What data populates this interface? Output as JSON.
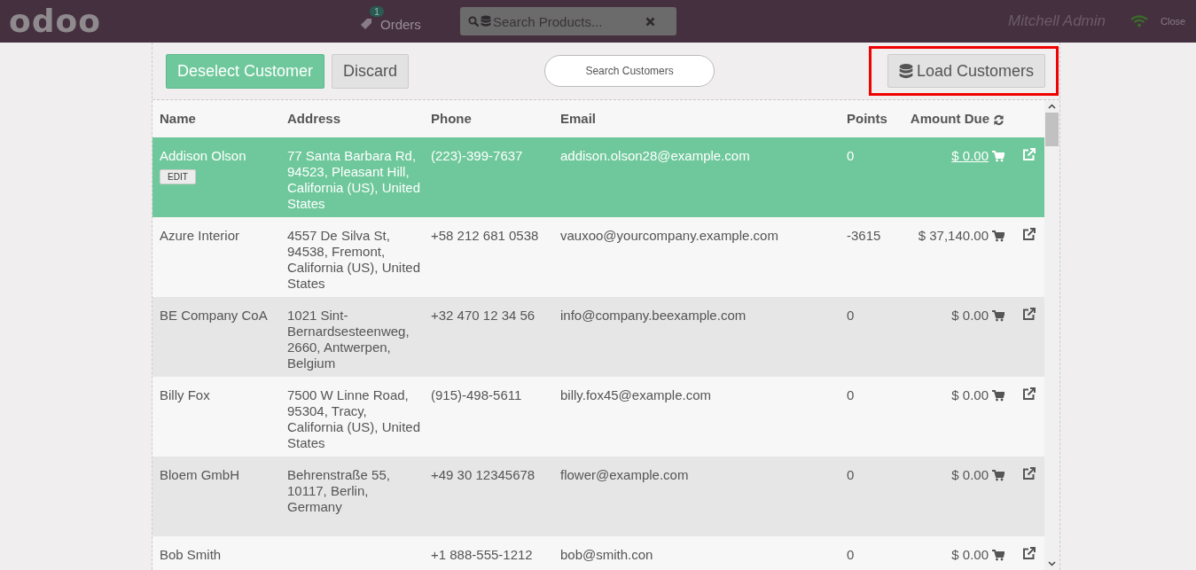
{
  "topbar": {
    "logo": "odoo",
    "orders": {
      "label": "Orders",
      "count": "1"
    },
    "product_search": {
      "placeholder": "Search Products..."
    },
    "user": "Mitchell Admin",
    "close": "Close"
  },
  "toolbar": {
    "deselect": "Deselect Customer",
    "discard": "Discard",
    "customer_search": {
      "placeholder": "Search Customers"
    },
    "load": {
      "label": "Load Customers",
      "highlighted": true
    }
  },
  "table": {
    "columns": [
      "Name",
      "Address",
      "Phone",
      "Email",
      "Points",
      "Amount Due"
    ],
    "rows": [
      {
        "selected": true,
        "name": "Addison Olson",
        "edit": "EDIT",
        "address": "77 Santa Barbara Rd, 94523, Pleasant Hill, California (US), United States",
        "phone": "(223)-399-7637",
        "email": "addison.olson28@example.com",
        "points": "0",
        "amount_due": "$ 0.00"
      },
      {
        "selected": false,
        "name": "Azure Interior",
        "address": "4557 De Silva St, 94538, Fremont, California (US), United States",
        "phone": "+58 212 681 0538",
        "email": "vauxoo@yourcompany.example.com",
        "points": "-3615",
        "amount_due": "$ 37,140.00"
      },
      {
        "selected": false,
        "name": "BE Company CoA",
        "address": "1021 Sint-Bernardsesteenweg, 2660, Antwerpen, Belgium",
        "phone": "+32 470 12 34 56",
        "email": "info@company.beexample.com",
        "points": "0",
        "amount_due": "$ 0.00"
      },
      {
        "selected": false,
        "name": "Billy Fox",
        "address": "7500 W Linne Road, 95304, Tracy, California (US), United States",
        "phone": "(915)-498-5611",
        "email": "billy.fox45@example.com",
        "points": "0",
        "amount_due": "$ 0.00"
      },
      {
        "selected": false,
        "name": "Bloem GmbH",
        "address": "Behrenstraße 55, 10117, Berlin, Germany",
        "phone": "+49 30 12345678",
        "email": "flower@example.com",
        "points": "0",
        "amount_due": "$ 0.00"
      },
      {
        "selected": false,
        "name": "Bob Smith",
        "address": "",
        "phone": "+1 888-555-1212",
        "email": "bob@smith.con",
        "points": "0",
        "amount_due": "$ 0.00"
      }
    ]
  }
}
